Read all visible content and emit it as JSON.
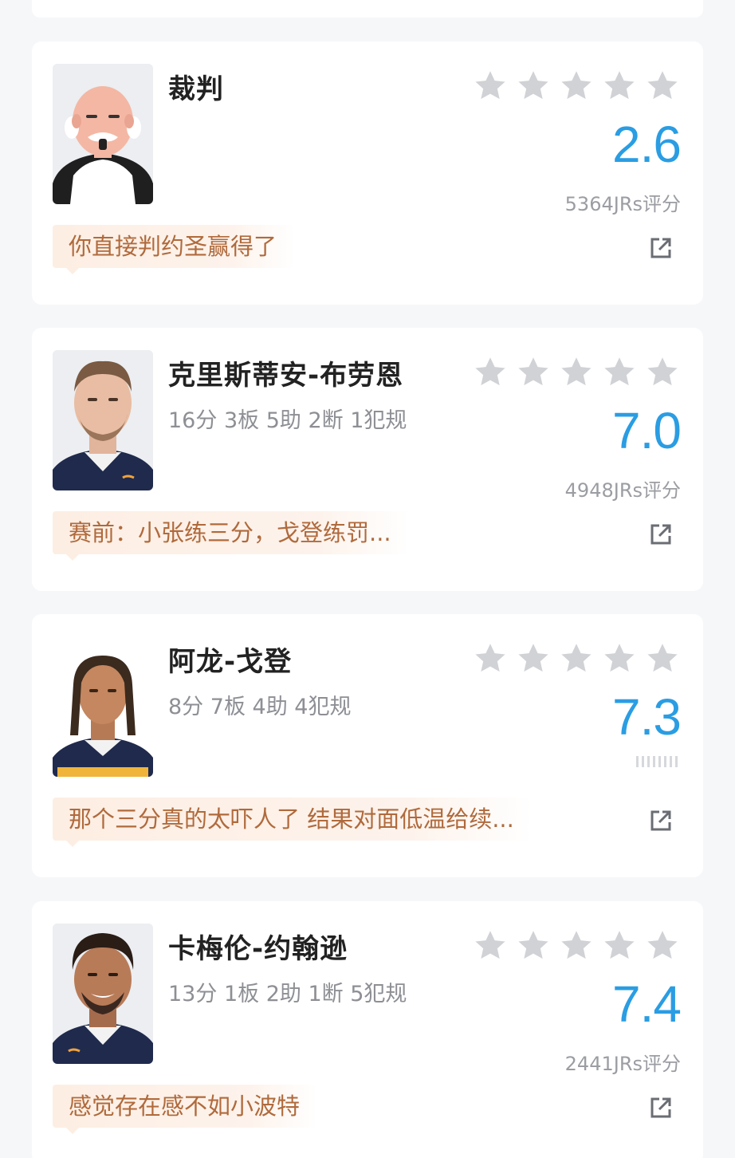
{
  "colors": {
    "score": "#2a9de3",
    "star": "#d0d2d6",
    "comment_text": "#b06a3c",
    "comment_bg": "#fdeee3"
  },
  "players": [
    {
      "name": "裁判",
      "stats": "",
      "score": "2.6",
      "votes": "5364JRs评分",
      "comment": "你直接判约圣赢得了",
      "avatar_icon": "referee-cartoon"
    },
    {
      "name": "克里斯蒂安-布劳恩",
      "stats": "16分 3板 5助 2断 1犯规",
      "score": "7.0",
      "votes": "4948JRs评分",
      "comment": "赛前：小张练三分，戈登练罚...",
      "avatar_icon": "player-photo"
    },
    {
      "name": "阿龙-戈登",
      "stats": "8分 7板 4助 4犯规",
      "score": "7.3",
      "votes": "",
      "comment": "那个三分真的太吓人了 结果对面低温给续...",
      "avatar_icon": "player-photo"
    },
    {
      "name": "卡梅伦-约翰逊",
      "stats": "13分 1板 2助 1断 5犯规",
      "score": "7.4",
      "votes": "2441JRs评分",
      "comment": "感觉存在感不如小波特",
      "avatar_icon": "player-photo"
    }
  ]
}
